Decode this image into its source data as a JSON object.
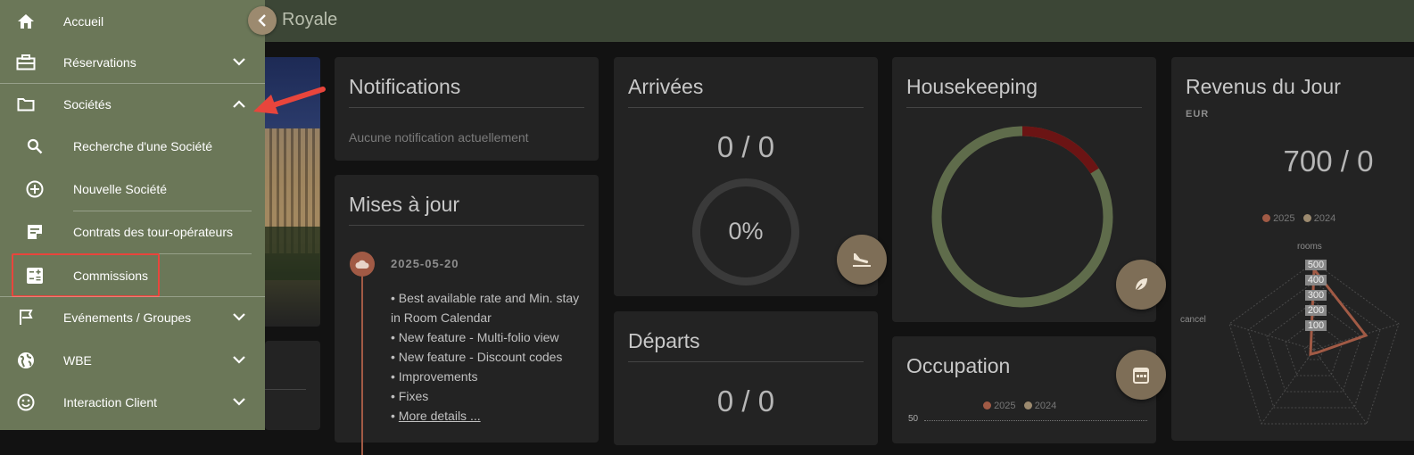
{
  "app": {
    "title": "Royale"
  },
  "sidebar": {
    "items": [
      {
        "label": "Accueil",
        "icon": "home-icon"
      },
      {
        "label": "Réservations",
        "icon": "briefcase-icon"
      },
      {
        "label": "Sociétés",
        "icon": "folder-icon"
      },
      {
        "label": "Recherche d'une Société",
        "icon": "search-icon"
      },
      {
        "label": "Nouvelle Société",
        "icon": "add-circle-icon"
      },
      {
        "label": "Contrats des tour-opérateurs",
        "icon": "note-edit-icon"
      },
      {
        "label": "Commissions",
        "icon": "calculator-icon"
      },
      {
        "label": "Evénements / Groupes",
        "icon": "flag-icon"
      },
      {
        "label": "WBE",
        "icon": "globe-icon"
      },
      {
        "label": "Interaction Client",
        "icon": "smiley-icon"
      }
    ]
  },
  "notifications": {
    "title": "Notifications",
    "empty_text": "Aucune notification actuellement"
  },
  "updates": {
    "title": "Mises à jour",
    "date": "2025-05-20",
    "items": [
      "• Best available rate and Min. stay",
      "in Room Calendar",
      "• New feature - Multi-folio view",
      "• New feature - Discount codes",
      "• Improvements",
      "• Fixes"
    ],
    "bullet": "•",
    "more_link": "More details ..."
  },
  "arrivals": {
    "title": "Arrivées",
    "count": "0 / 0",
    "percent": "0%",
    "progress": 0
  },
  "departures": {
    "title": "Départs",
    "count": "0 / 0"
  },
  "housekeeping": {
    "title": "Housekeeping",
    "dirty_fraction": 0.16
  },
  "occupation": {
    "title": "Occupation",
    "legend_2025": "2025",
    "legend_2024": "2024",
    "y_tick": "50"
  },
  "revenue": {
    "title": "Revenus du Jour",
    "currency": "EUR",
    "value": "700 / 0",
    "legend_2025": "2025",
    "legend_2024": "2024",
    "axis_rooms": "rooms",
    "axis_cancel": "cancel",
    "ticks": [
      "500",
      "400",
      "300",
      "200",
      "100"
    ]
  },
  "colors": {
    "sidebar": "#6b7758",
    "topbar": "#3c4636",
    "accent": "#7e6e57",
    "series2025": "#a15a45",
    "series2024": "#9c8a6f",
    "alert": "#e8453c"
  }
}
